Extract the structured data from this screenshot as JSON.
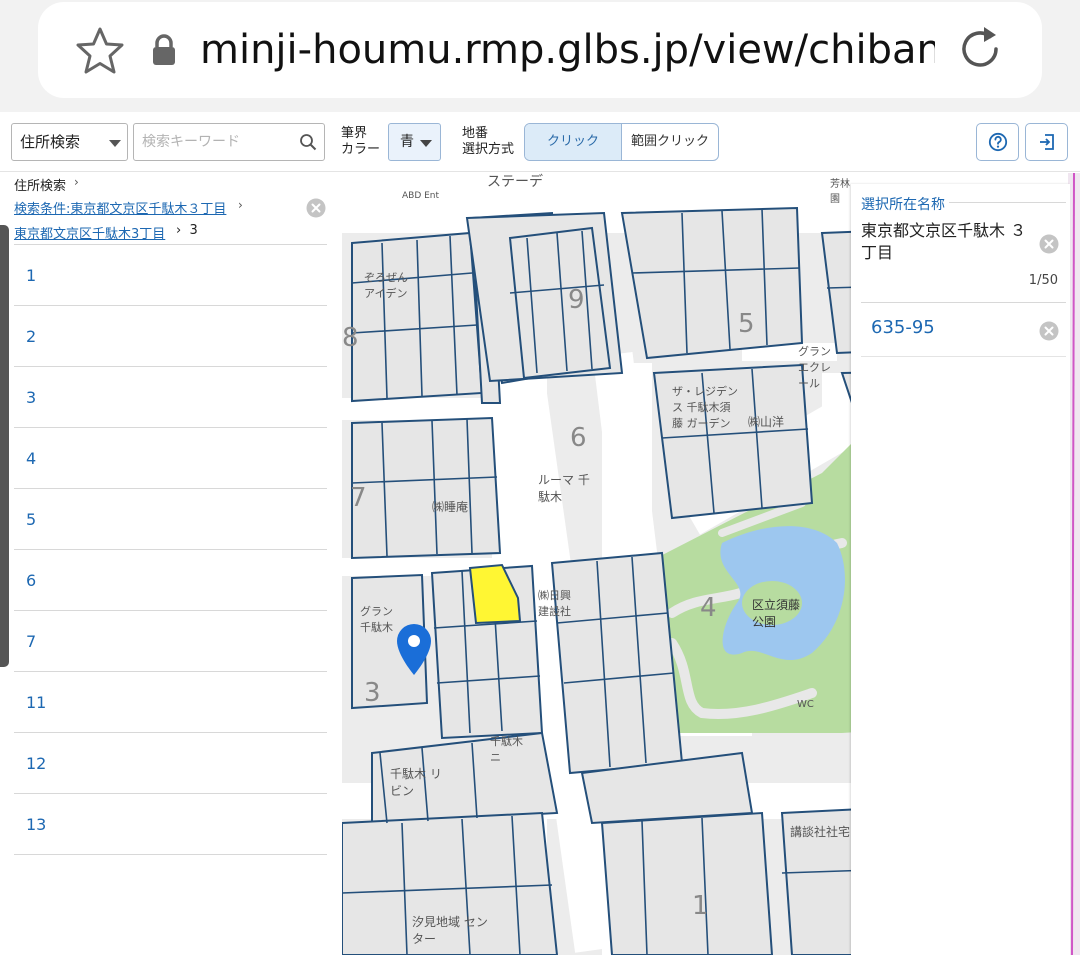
{
  "browser": {
    "url": "minji-houmu.rmp.glbs.jp/view/chiban_",
    "icons": [
      "star-icon",
      "lock-icon",
      "reload-icon"
    ]
  },
  "toolbar": {
    "address_search_label": "住所検索",
    "search_placeholder": "検索キーワード",
    "border_color_label_1": "筆界",
    "border_color_label_2": "カラー",
    "border_color_value": "青",
    "selection_label_1": "地番",
    "selection_label_2": "選択方式",
    "mode_click": "クリック",
    "mode_range": "範囲クリック",
    "icons": [
      "help-icon",
      "logout-icon",
      "search-icon"
    ]
  },
  "left_panel": {
    "breadcrumb_root": "住所検索",
    "breadcrumb_condition": "検索条件:東京都文京区千駄木３丁目",
    "breadcrumb_area": "東京都文京区千駄木3丁目",
    "breadcrumb_current": "3",
    "separator": "›",
    "items": [
      "1",
      "2",
      "3",
      "4",
      "5",
      "6",
      "7",
      "11",
      "12",
      "13"
    ]
  },
  "map": {
    "labels": {
      "station": "ステーデ",
      "abd": "ABD Ent",
      "zorosen": "ぞろぜん アイデン",
      "block9": "9",
      "block6": "6",
      "block5": "5",
      "block7": "7",
      "block4": "4",
      "block3": "3",
      "block8": "8",
      "block1": "1",
      "residence": "ザ・レジデンス 千駄木須藤 ガーデン",
      "granclair": "グランエクレール",
      "yamayo": "㈱山洋",
      "roomaa": "ルーマ 千駄木",
      "suimin": "㈱睡庵",
      "nichietsu": "㈱日興 建設社",
      "gran": "グラン 千駄木",
      "sendagi_ribon": "千駄木 リビン",
      "kodansha": "講談社社宅",
      "park": "区立須藤 公園",
      "wc": "WC",
      "center": "汐見地域 センター",
      "sengoku": "千駄木ニ",
      "hooniwa": "芳林園"
    }
  },
  "right_panel": {
    "title": "選択所在名称",
    "location_name": "東京都文京区千駄木 ３丁目",
    "count": "1/50",
    "parcel": "635-95",
    "icons": [
      "clear-icon"
    ]
  },
  "colors": {
    "accent_blue": "#1d68b2",
    "parcel_line": "#244f7a",
    "selected_parcel": "#fff633",
    "park_green": "#b7dca0",
    "pond_blue": "#9dc7ef",
    "pin_blue": "#1a6ed8"
  }
}
